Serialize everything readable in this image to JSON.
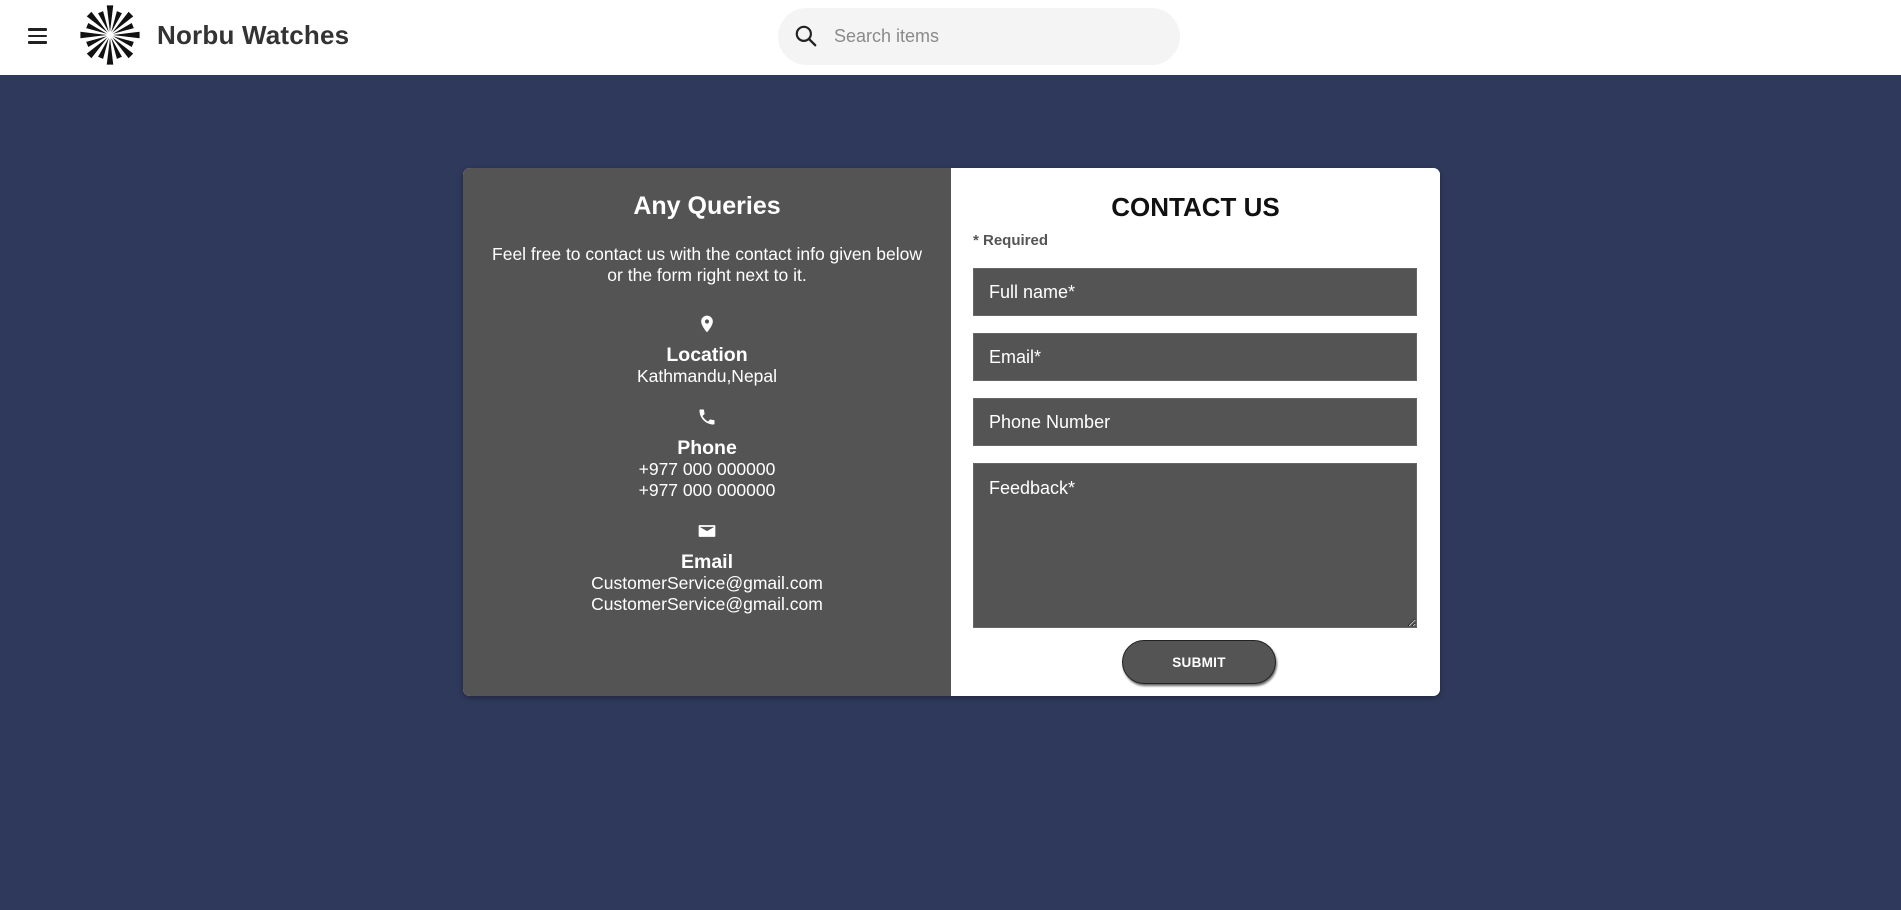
{
  "header": {
    "brand": "Norbu Watches",
    "menu_icon": "hamburger-menu-icon",
    "logo_icon": "starburst-logo-icon",
    "search": {
      "icon": "search-icon",
      "placeholder": "Search items",
      "value": ""
    }
  },
  "info": {
    "title": "Any Queries",
    "description": "Feel free to contact us with the contact info given below or the form right next to it.",
    "location": {
      "icon": "location-pin-icon",
      "label": "Location",
      "value": "Kathmandu,Nepal"
    },
    "phone": {
      "icon": "phone-icon",
      "label": "Phone",
      "lines": [
        "+977 000 000000",
        "+977 000 000000"
      ]
    },
    "email": {
      "icon": "envelope-icon",
      "label": "Email",
      "lines": [
        "CustomerService@gmail.com",
        "CustomerService@gmail.com"
      ]
    }
  },
  "form": {
    "title": "CONTACT US",
    "required_note": "* Required",
    "fields": {
      "full_name": {
        "placeholder": "Full name*",
        "value": ""
      },
      "email": {
        "placeholder": "Email*",
        "value": ""
      },
      "phone": {
        "placeholder": "Phone Number",
        "value": ""
      },
      "feedback": {
        "placeholder": "Feedback*",
        "value": ""
      }
    },
    "submit_label": "SUBMIT"
  },
  "colors": {
    "page_background": "#2f395b",
    "panel_gray": "#545454",
    "header_background": "#ffffff",
    "search_background": "#f4f4f4"
  }
}
